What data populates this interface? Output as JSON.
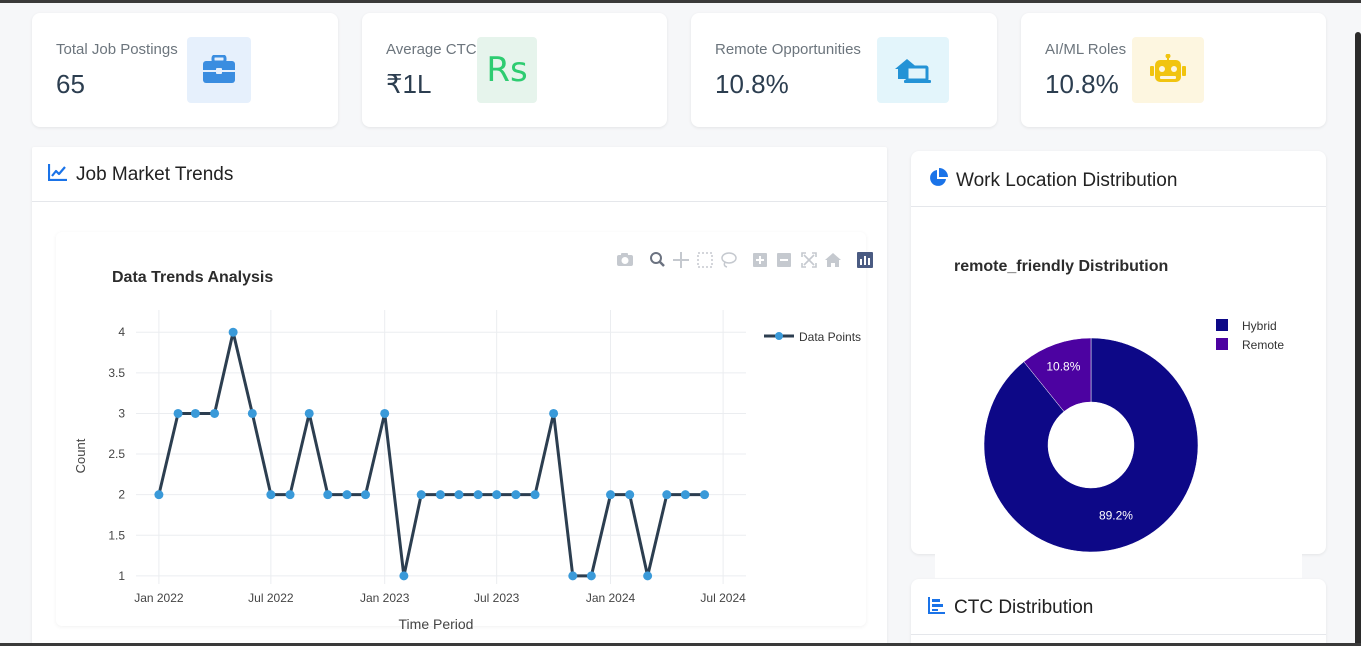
{
  "stats": [
    {
      "label": "Total Job Postings",
      "value": "65",
      "icon": "briefcase-icon",
      "bg": "#e6f0fc",
      "color": "#3a8de0"
    },
    {
      "label": "Average CTC",
      "value": "₹1L",
      "icon": "rupee-icon",
      "bg": "#e6f4ec",
      "color": "#2ecc71",
      "glyph": "Rs"
    },
    {
      "label": "Remote Opportunities",
      "value": "10.8%",
      "icon": "laptop-house-icon",
      "bg": "#e3f5fb",
      "color": "#2493d6"
    },
    {
      "label": "AI/ML Roles",
      "value": "10.8%",
      "icon": "robot-icon",
      "bg": "#fdf6e0",
      "color": "#f1c40f"
    }
  ],
  "trends_panel": {
    "title": "Job Market Trends",
    "icon": "line-chart-icon"
  },
  "location_panel": {
    "title": "Work Location Distribution",
    "icon": "pie-chart-icon"
  },
  "ctc_panel": {
    "title": "CTC Distribution",
    "icon": "bar-chart-icon"
  },
  "toolbar": [
    "camera-icon",
    "zoom-icon",
    "pan-icon",
    "box-select-icon",
    "lasso-icon",
    "zoom-in-icon",
    "zoom-out-icon",
    "autoscale-icon",
    "reset-axes-icon",
    "plotly-logo-icon"
  ],
  "chart_data": [
    {
      "type": "line",
      "title": "Data Trends Analysis",
      "xlabel": "Time Period",
      "ylabel": "Count",
      "x_ticks": [
        "Jan 2022",
        "Jul 2022",
        "Jan 2023",
        "Jul 2023",
        "Jan 2024",
        "Jul 2024"
      ],
      "y_ticks": [
        "1",
        "1.5",
        "2",
        "2.5",
        "3",
        "3.5",
        "4"
      ],
      "ylim": [
        0.9,
        4.2
      ],
      "legend_position": "top-right",
      "line_color": "#2c3e50",
      "marker_color": "#3a9ad9",
      "series": [
        {
          "name": "Data Points",
          "x": [
            "2022-01",
            "2022-02",
            "2022-03",
            "2022-04",
            "2022-05",
            "2022-06",
            "2022-07",
            "2022-08",
            "2022-09",
            "2022-10",
            "2022-11",
            "2022-12",
            "2023-01",
            "2023-02",
            "2023-03",
            "2023-04",
            "2023-05",
            "2023-06",
            "2023-07",
            "2023-08",
            "2023-09",
            "2023-10",
            "2023-11",
            "2023-12",
            "2024-01",
            "2024-02",
            "2024-03",
            "2024-04",
            "2024-05",
            "2024-06"
          ],
          "values": [
            2,
            3,
            3,
            3,
            4,
            3,
            2,
            2,
            3,
            2,
            2,
            2,
            3,
            1,
            2,
            2,
            2,
            2,
            2,
            2,
            2,
            3,
            1,
            1,
            2,
            2,
            1,
            2,
            2,
            2
          ]
        }
      ]
    },
    {
      "type": "pie",
      "title": "remote_friendly Distribution",
      "legend_position": "top-right",
      "labels": [
        "Hybrid",
        "Remote"
      ],
      "values": [
        89.2,
        10.8
      ],
      "value_labels": [
        "89.2%",
        "10.8%"
      ],
      "colors": [
        "#0d0887",
        "#4c02a1"
      ]
    }
  ]
}
